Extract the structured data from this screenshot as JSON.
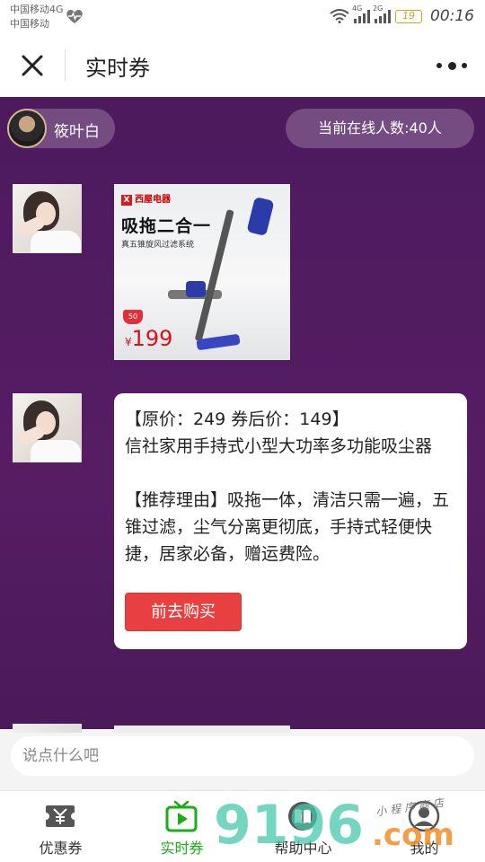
{
  "status_bar": {
    "carrier1": "中国移动4G",
    "carrier2": "中国移动",
    "net1": "4G",
    "net2": "2G",
    "battery": "19",
    "time": "00:16"
  },
  "nav": {
    "title": "实时券"
  },
  "room": {
    "host_name": "筱叶白",
    "online_label": "当前在线人数:40人"
  },
  "product_image": {
    "brand": "西屋电器",
    "headline": "吸拖二合一",
    "subline": "真五锥旋风过滤系统",
    "badge": "50",
    "price_symbol": "¥",
    "price": "199"
  },
  "message": {
    "line1": "【原价：249 券后价：149】",
    "line2": "信社家用手持式小型大功率多功能吸尘器",
    "line3": "【推荐理由】吸拖一体，清洁只需一遍，五锥过滤，尘气分离更彻底，手持式轻便快捷，居家必备，赠运费险。",
    "button": "前去购买"
  },
  "input": {
    "placeholder": "说点什么吧"
  },
  "tabs": [
    {
      "label": "优惠券"
    },
    {
      "label": "实时券"
    },
    {
      "label": "帮助中心"
    },
    {
      "label": "我的"
    }
  ],
  "watermark": {
    "big": "9196",
    "com": ".com",
    "hand": "小程序商店"
  },
  "colors": {
    "chat_bg": "#4d1a5e",
    "accent_green": "#1aad19",
    "buy_red": "#e84040"
  }
}
